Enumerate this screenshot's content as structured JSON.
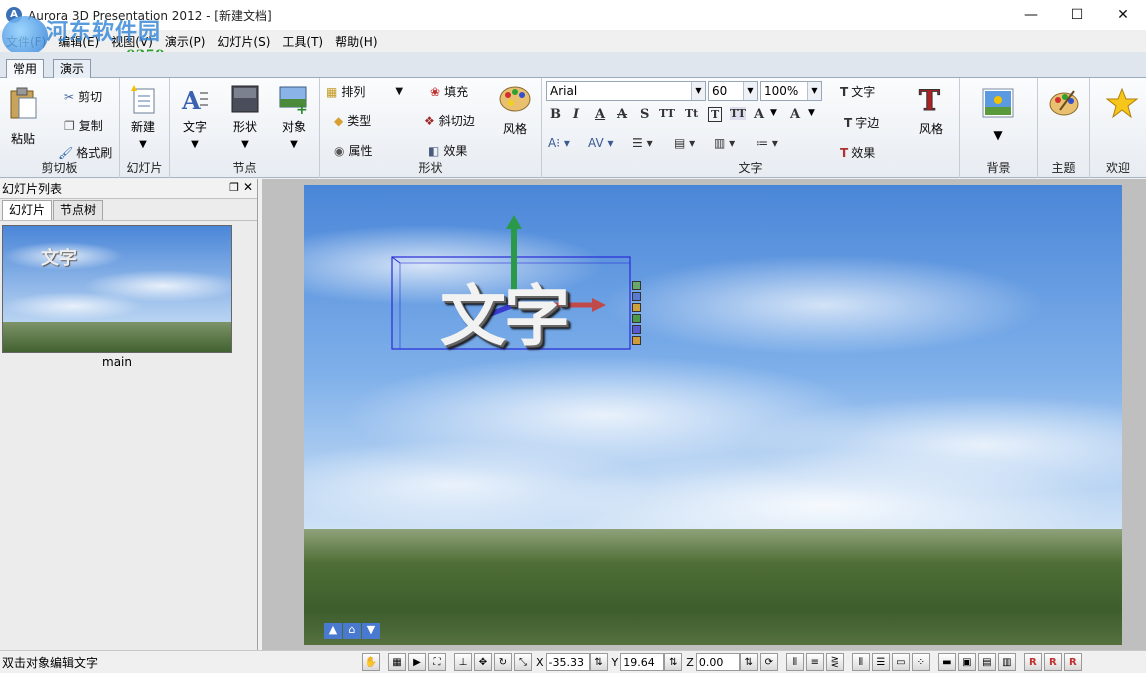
{
  "window": {
    "title": "Aurora 3D Presentation 2012 - [新建文档]",
    "controls": {
      "minimize": "—",
      "maximize": "☐",
      "close": "✕"
    }
  },
  "watermark": {
    "name": "河东软件园",
    "url": "www.pc0359.cn"
  },
  "menu": [
    "文件(F)",
    "编辑(E)",
    "视图(V)",
    "演示(P)",
    "幻灯片(S)",
    "工具(T)",
    "帮助(H)"
  ],
  "ribbon_tabs": [
    "常用",
    "演示"
  ],
  "ribbon": {
    "clipboard": {
      "paste": "粘贴",
      "cut": "剪切",
      "copy": "复制",
      "format_painter": "格式刷",
      "label": "剪切板"
    },
    "slide": {
      "new": "新建",
      "label": "幻灯片"
    },
    "node": {
      "text": "文字",
      "shape": "形状",
      "object": "对象",
      "label": "节点"
    },
    "shape": {
      "arrange": "排列",
      "type": "类型",
      "property": "属性",
      "fill": "填充",
      "bevel": "斜切边",
      "effect": "效果",
      "style": "风格",
      "label": "形状"
    },
    "text": {
      "font": "Arial",
      "size": "60",
      "zoom": "100%",
      "text_btn": "文字",
      "edge": "字边",
      "effect": "效果",
      "style": "风格",
      "label": "文字",
      "format_glyphs": [
        "B",
        "I",
        "A",
        "A",
        "S",
        "TT",
        "Tt",
        "T",
        "TT",
        "A",
        "A"
      ]
    },
    "background": {
      "label": "背景"
    },
    "theme": {
      "label": "主题"
    },
    "welcome": {
      "label": "欢迎"
    }
  },
  "slide_panel": {
    "title": "幻灯片列表",
    "tabs": [
      "幻灯片",
      "节点树"
    ],
    "thumb_text": "文字",
    "slide_name": "main"
  },
  "canvas": {
    "text3d": "文字"
  },
  "status": {
    "hint": "双击对象编辑文字",
    "x_label": "X",
    "x": "-35.33",
    "y_label": "Y",
    "y": "19.64",
    "z_label": "Z",
    "z": "0.00"
  },
  "colors": {
    "accent": "#3b6fb6",
    "selection": "#2a2ad8"
  }
}
